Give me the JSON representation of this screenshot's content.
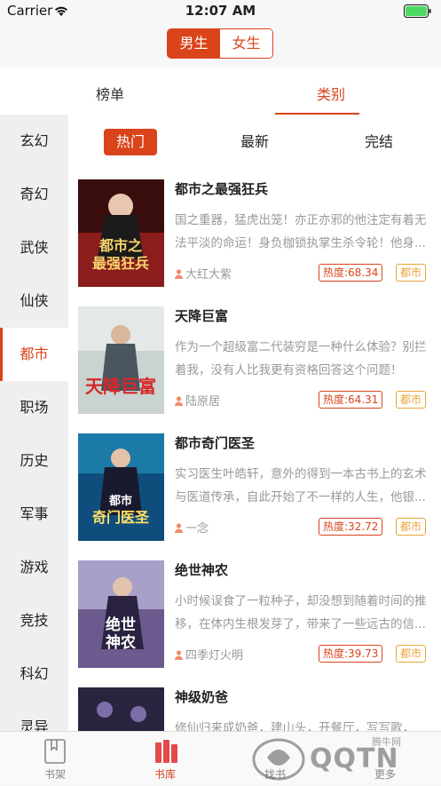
{
  "status": {
    "carrier": "Carrier",
    "time": "12:07 AM"
  },
  "gender": {
    "male": "男生",
    "female": "女生"
  },
  "top_tabs": {
    "ranking": "榜单",
    "category": "类别"
  },
  "sidebar": [
    "玄幻",
    "奇幻",
    "武侠",
    "仙侠",
    "都市",
    "职场",
    "历史",
    "军事",
    "游戏",
    "竞技",
    "科幻",
    "灵异"
  ],
  "filters": {
    "hot": "热门",
    "newest": "最新",
    "finished": "完结"
  },
  "books": [
    {
      "title": "都市之最强狂兵",
      "desc": "国之重器，猛虎出笼！亦正亦邪的他注定有着无法平淡的命运！身负枷锁执掌生杀令轮！他身...",
      "author": "大红大紫",
      "heat": "热度:68.34",
      "category": "都市",
      "cover_title": "都市之最强狂兵",
      "cover_color": "#8b1d1d"
    },
    {
      "title": "天降巨富",
      "desc": "作为一个超级富二代装穷是一种什么体验？别拦着我，没有人比我更有资格回答这个问题！",
      "author": "陆原居",
      "heat": "热度:64.31",
      "category": "都市",
      "cover_title": "天降巨富",
      "cover_color": "#c9d3cf"
    },
    {
      "title": "都市奇门医圣",
      "desc": "实习医生叶皓轩，意外的得到一本古书上的玄术与医道传承，自此开始了不一样的人生，他银...",
      "author": "一念",
      "heat": "热度:32.72",
      "category": "都市",
      "cover_title": "都市奇门医圣",
      "cover_color": "#0f4e7c"
    },
    {
      "title": "绝世神农",
      "desc": "小时候误食了一粒种子，却没想到随着时间的推移，在体内生根发芽了，带来了一些远古的信...",
      "author": "四季灯火明",
      "heat": "热度:39.73",
      "category": "都市",
      "cover_title": "绝世神农",
      "cover_color": "#6b5a8e"
    },
    {
      "title": "神级奶爸",
      "desc": "修仙归来成奶爸，建山头，开餐厅，写写歌，泡...",
      "author": "",
      "heat": "",
      "category": "",
      "cover_title": "",
      "cover_color": "#2a2440"
    }
  ],
  "tabbar": {
    "shelf": "书架",
    "library": "书库",
    "find": "找书",
    "more": "更多"
  },
  "watermark": {
    "text": "QQTN",
    "small": "腾牛网"
  },
  "colors": {
    "accent": "#d9441b",
    "badge": "#e8a43a"
  }
}
